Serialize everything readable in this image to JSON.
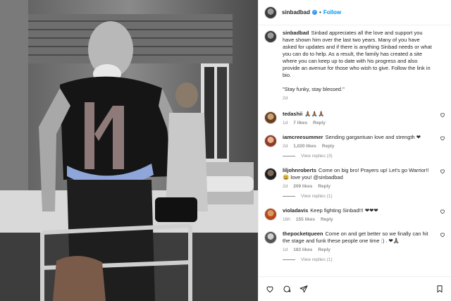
{
  "post": {
    "username": "sinbadbad",
    "follow_label": "Follow",
    "caption": "Sinbad appreciates all the love and support you have shown him over the last two years. Many of you have asked for updates and if there is anything Sinbad needs or what you can do to help. As a result, the family has created a site where you can keep up to date with his progress and also provide an avenue for those who wish to give. Follow the link in bio.",
    "quote": "\"Stay funky, stay blessed.\"",
    "age": "2d"
  },
  "comments": [
    {
      "user": "tedashii",
      "text": "🙏🏾🙏🏾🙏🏾",
      "age": "1d",
      "likes": "7 likes",
      "reply": "Reply",
      "view_replies": ""
    },
    {
      "user": "iamcreesummer",
      "text": "Sending gargantuan love and strength ❤",
      "age": "2d",
      "likes": "1,020 likes",
      "reply": "Reply",
      "view_replies": "View replies (3)"
    },
    {
      "user": "liljohnroberts",
      "text": "Come on big bro! Prayers up! Let's go Warrior!! 😃 love you! @sinbadbad",
      "age": "2d",
      "likes": "209 likes",
      "reply": "Reply",
      "view_replies": "View replies (1)"
    },
    {
      "user": "violadavis",
      "text": "Keep fighting Sinbad!!! ❤❤❤",
      "age": "16h",
      "likes": "155 likes",
      "reply": "Reply",
      "view_replies": ""
    },
    {
      "user": "thepocketqueen",
      "text": "Come on and get better so we finally can hit the stage and funk these people one time :) . ❤🙏🏾",
      "age": "1d",
      "likes": "183 likes",
      "reply": "Reply",
      "view_replies": "View replies (1)"
    }
  ],
  "colors": {
    "link": "#0095f6",
    "muted": "#8e8e8e",
    "verified": "#3897f0"
  }
}
